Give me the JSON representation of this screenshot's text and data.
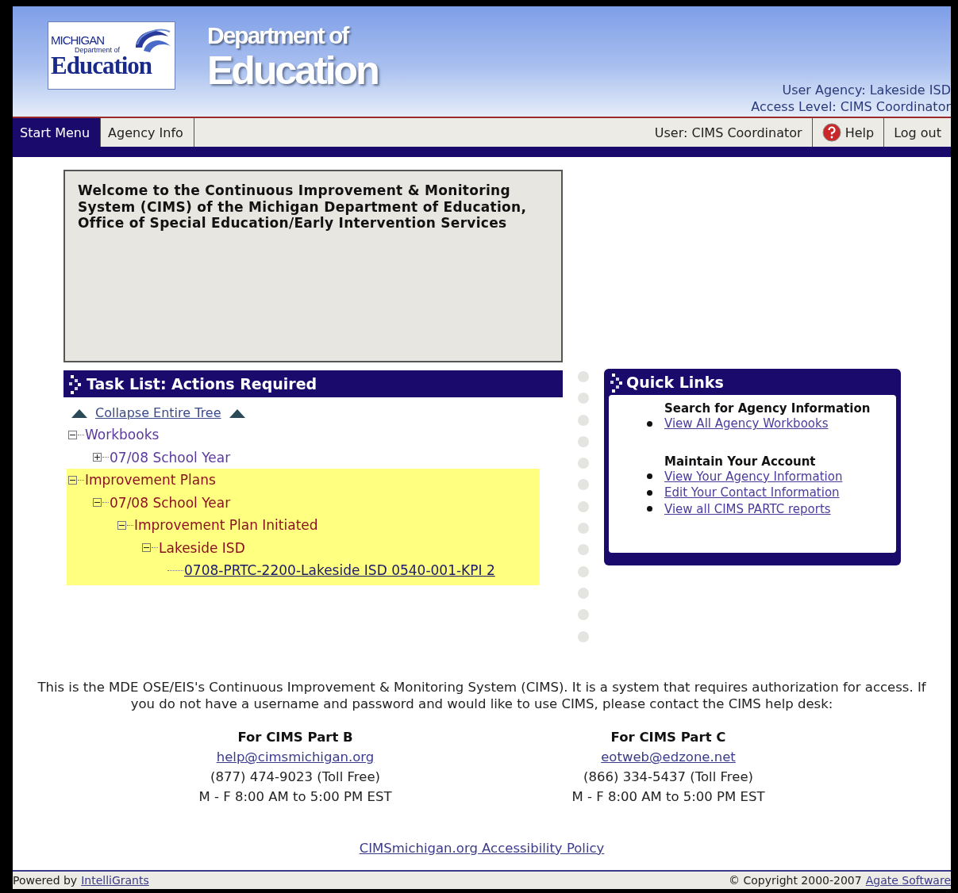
{
  "header": {
    "logo": {
      "line_1": "MICHIGAN",
      "line_2": "Department of",
      "line_3": "Education"
    },
    "title_1": "Department of",
    "title_2": "Education",
    "user_agency": "User Agency: Lakeside ISD",
    "access_level": "Access Level: CIMS Coordinator"
  },
  "nav": {
    "tabs": [
      {
        "label": "Start Menu",
        "selected": true
      },
      {
        "label": "Agency Info",
        "selected": false
      }
    ],
    "user": "User: CIMS Coordinator",
    "help": "Help",
    "logout": "Log out"
  },
  "welcome": "Welcome to the Continuous Improvement & Monitoring System (CIMS) of the Michigan Department of Education, Office of Special Education/Early Intervention Services",
  "task_list": {
    "title": "Task List: Actions Required",
    "collapse": "Collapse Entire Tree",
    "tree": [
      {
        "label": "Workbooks",
        "expanded": true,
        "highlighted": false,
        "children": [
          {
            "label": "07/08 School Year",
            "expanded": false
          }
        ]
      },
      {
        "label": "Improvement Plans",
        "expanded": true,
        "highlighted": true,
        "children": [
          {
            "label": "07/08 School Year",
            "expanded": true,
            "children": [
              {
                "label": "Improvement Plan Initiated",
                "expanded": true,
                "children": [
                  {
                    "label": "Lakeside ISD",
                    "expanded": true,
                    "children": [
                      {
                        "label": "0708-PRTC-2200-Lakeside ISD 0540-001-KPI 2",
                        "kind": "link"
                      }
                    ]
                  }
                ]
              }
            ]
          }
        ]
      }
    ]
  },
  "quick_links": {
    "title": "Quick Links",
    "sections": [
      {
        "heading": "Search for Agency Information",
        "links": [
          "View All Agency Workbooks"
        ]
      },
      {
        "heading": "Maintain Your Account",
        "links": [
          "View Your Agency Information",
          "Edit Your Contact Information",
          "View all CIMS  PARTC reports"
        ]
      }
    ]
  },
  "footer": {
    "notice": "This is the MDE OSE/EIS's Continuous Improvement & Monitoring System (CIMS). It is a system that requires authorization for access. If you do not have a username and password and would like to use CIMS, please contact the CIMS help desk:",
    "contacts": [
      {
        "title": "For CIMS Part B",
        "email": "help@cimsmichigan.org",
        "phone": "(877) 474-9023 (Toll Free)",
        "hours": "M - F 8:00 AM to 5:00 PM EST"
      },
      {
        "title": "For CIMS Part C",
        "email": "eotweb@edzone.net",
        "phone": "(866) 334-5437 (Toll Free)",
        "hours": "M - F 8:00 AM to 5:00 PM EST"
      }
    ],
    "accessibility": "CIMSmichigan.org Accessibility Policy"
  },
  "bottom_bar": {
    "powered": "Powered by",
    "powered_link": "IntelliGrants",
    "copyright": "© Copyright 2000-2007",
    "copyright_link": "Agate Software"
  }
}
